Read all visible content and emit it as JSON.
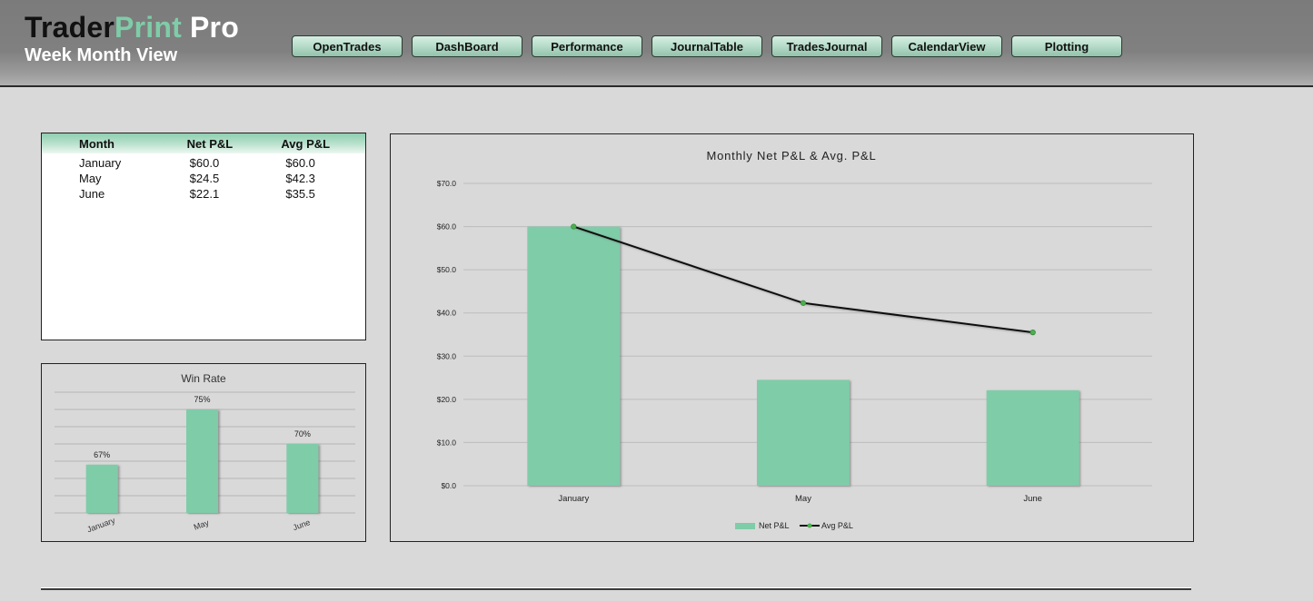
{
  "header": {
    "brand": {
      "part1": "Trader",
      "part2": "Print",
      "part3": " Pro"
    },
    "subtitle": "Week Month View",
    "nav": [
      "OpenTrades",
      "DashBoard",
      "Performance",
      "JournalTable",
      "TradesJournal",
      "CalendarView",
      "Plotting"
    ]
  },
  "colors": {
    "accent": "#7fcca8",
    "bar": "#7fcca8",
    "line": "#111111",
    "marker": "#4caf50"
  },
  "summary_table": {
    "headers": [
      "Month",
      "Net P&L",
      "Avg P&L"
    ],
    "rows": [
      [
        "January",
        "$60.0",
        "$60.0"
      ],
      [
        "May",
        "$24.5",
        "$42.3"
      ],
      [
        "June",
        "$22.1",
        "$35.5"
      ]
    ]
  },
  "chart_data": [
    {
      "type": "bar",
      "title": "Win Rate",
      "categories": [
        "January",
        "May",
        "June"
      ],
      "values": [
        67,
        75,
        70
      ],
      "data_labels": [
        "67%",
        "75%",
        "70%"
      ],
      "ylim": [
        60,
        77.5
      ],
      "ystep": 2.5,
      "grid": true,
      "xlabel": "",
      "ylabel": ""
    },
    {
      "type": "bar",
      "title": "Monthly Net P&L & Avg. P&L",
      "categories": [
        "January",
        "May",
        "June"
      ],
      "series": [
        {
          "name": "Net P&L",
          "type": "bar",
          "values": [
            60.0,
            24.5,
            22.1
          ]
        },
        {
          "name": "Avg P&L",
          "type": "line",
          "values": [
            60.0,
            42.3,
            35.5
          ]
        }
      ],
      "yticks": [
        "$0.0",
        "$10.0",
        "$20.0",
        "$30.0",
        "$40.0",
        "$50.0",
        "$60.0",
        "$70.0"
      ],
      "ylim": [
        0,
        70
      ],
      "ystep": 10,
      "grid": true,
      "legend": "bottom",
      "xlabel": "",
      "ylabel": ""
    }
  ]
}
